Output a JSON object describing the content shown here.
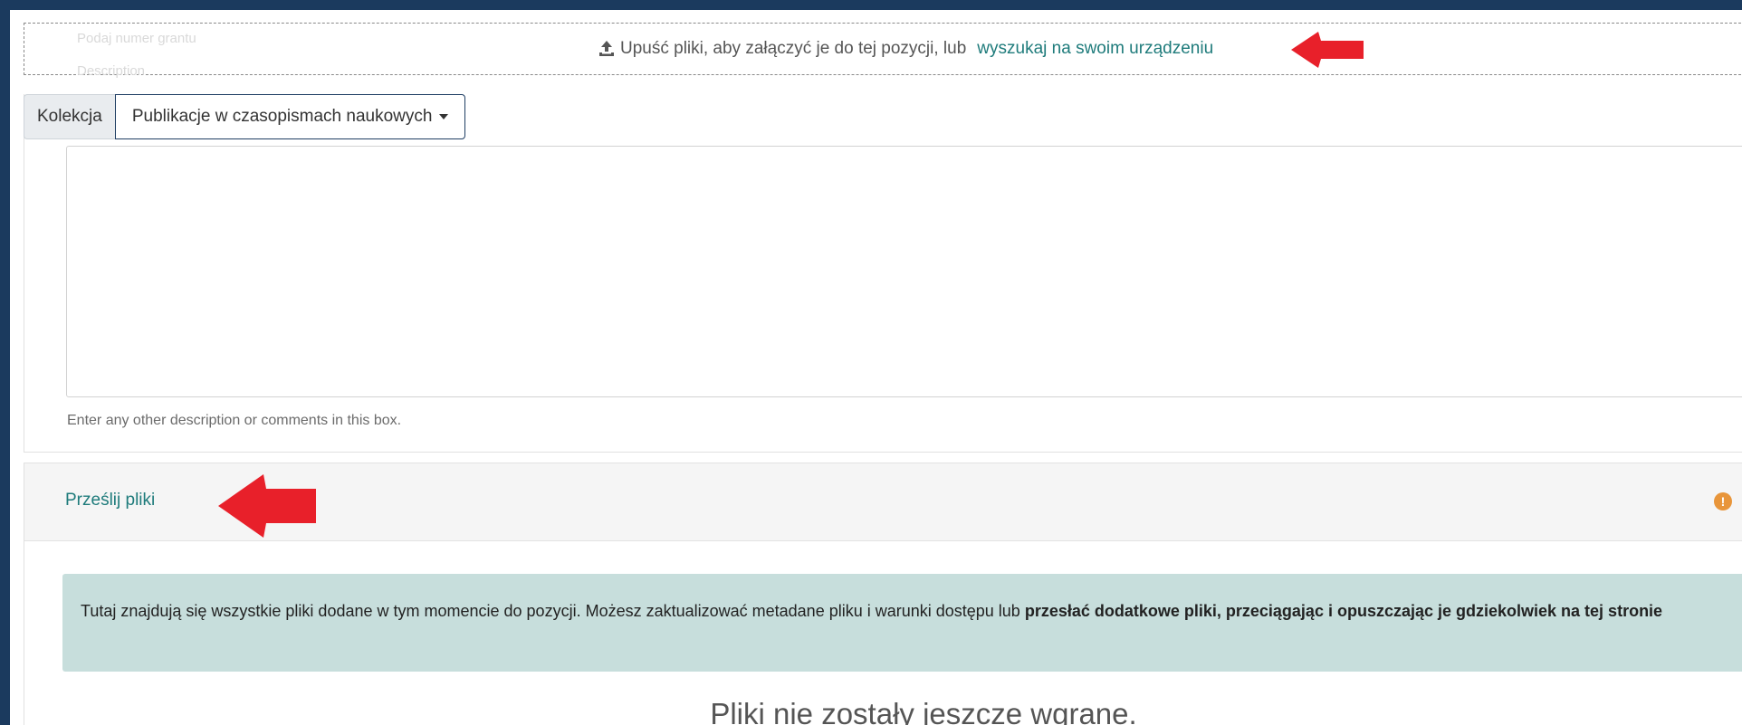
{
  "dropzone": {
    "ghost_top": "Podaj numer grantu",
    "ghost_bottom": "Description",
    "text": "Upuść pliki, aby załączyć je do tej pozycji, lub",
    "link": "wyszukaj na swoim urządzeniu"
  },
  "collection": {
    "label": "Kolekcja",
    "selected": "Publikacje w czasopismach naukowych"
  },
  "description": {
    "hint": "Enter any other description or comments in this box."
  },
  "upload": {
    "title": "Prześlij pliki",
    "info_normal": "Tutaj znajdują się wszystkie pliki dodane w tym momencie do pozycji. Możesz zaktualizować metadane pliku i warunki dostępu lub ",
    "info_bold": "przesłać dodatkowe pliki, przeciągając i opuszczając je gdziekolwiek na tej stronie",
    "empty": "Pliki nie zostały jeszcze wgrane.",
    "warning_glyph": "!"
  },
  "colors": {
    "frame": "#1b3a5e",
    "link": "#1e7b7b",
    "arrow": "#e8202a",
    "info_bg": "#c7dedc",
    "warning": "#e8953a"
  }
}
